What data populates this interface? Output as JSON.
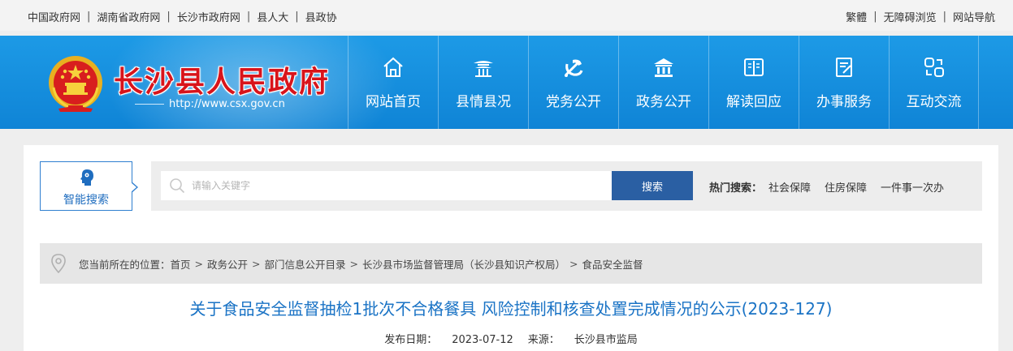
{
  "topbar": {
    "left_links": [
      "中国政府网",
      "湖南省政府网",
      "长沙市政府网",
      "县人大",
      "县政协"
    ],
    "separator": "|",
    "right_links": [
      "繁體",
      "无障碍浏览",
      "网站导航"
    ]
  },
  "header": {
    "site_title": "长沙县人民政府",
    "url": "http://www.csx.gov.cn",
    "emblem_icon": "national-emblem",
    "nav": [
      {
        "label": "网站首页",
        "icon": "home-icon"
      },
      {
        "label": "县情县况",
        "icon": "pavilion-icon"
      },
      {
        "label": "党务公开",
        "icon": "party-emblem-icon"
      },
      {
        "label": "政务公开",
        "icon": "government-building-icon"
      },
      {
        "label": "解读回应",
        "icon": "book-icon"
      },
      {
        "label": "办事服务",
        "icon": "form-edit-icon"
      },
      {
        "label": "互动交流",
        "icon": "exchange-icon"
      }
    ]
  },
  "search": {
    "smart_label": "智能搜索",
    "placeholder": "请输入关键字",
    "value": "",
    "button_label": "搜索",
    "hot_label": "热门搜索：",
    "hot_items": [
      "社会保障",
      "住房保障",
      "一件事一次办"
    ]
  },
  "breadcrumb": {
    "prefix": "您当前所在的位置：",
    "items": [
      "首页",
      "政务公开",
      "部门信息公开目录",
      "长沙县市场监督管理局（长沙县知识产权局）",
      "食品安全监督"
    ],
    "separator": ">"
  },
  "article": {
    "title": "关于食品安全监督抽检1批次不合格餐具 风险控制和核查处置完成情况的公示(2023-127)",
    "publish_label": "发布日期：",
    "publish_date": "2023-07-12",
    "source_label": "来源：",
    "source": "长沙县市监局"
  },
  "colors": {
    "header_blue": "#0f84d6",
    "title_red": "#d8141b",
    "search_button": "#2a5fa3",
    "article_title": "#1a73c5"
  }
}
